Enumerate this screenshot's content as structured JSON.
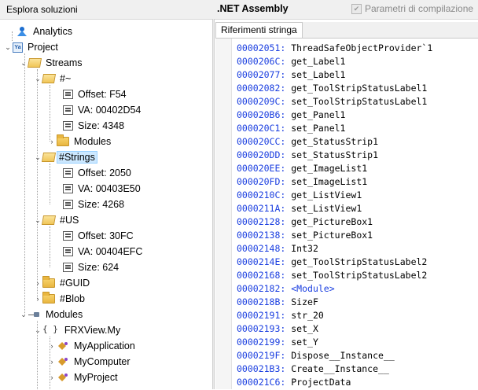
{
  "topbar": {
    "explorer_title": "Esplora soluzioni",
    "assembly_title": ".NET Assembly",
    "compile_params_label": "Parametri di compilazione",
    "compile_params_checked": true
  },
  "tree": {
    "analytics": "Analytics",
    "project": "Project",
    "streams": "Streams",
    "tilde": "#~",
    "tilde_offset": "Offset: F54",
    "tilde_va": "VA: 00402D54",
    "tilde_size": "Size: 4348",
    "tilde_modules": "Modules",
    "strings": "#Strings",
    "strings_offset": "Offset: 2050",
    "strings_va": "VA: 00403E50",
    "strings_size": "Size: 4268",
    "us": "#US",
    "us_offset": "Offset: 30FC",
    "us_va": "VA: 00404EFC",
    "us_size": "Size: 624",
    "guid": "#GUID",
    "blob": "#Blob",
    "modules": "Modules",
    "ns_brace": "{ }",
    "namespace": "FRXView.My",
    "cls1": "MyApplication",
    "cls2": "MyComputer",
    "cls3": "MyProject"
  },
  "panel": {
    "tab_label": "Riferimenti stringa"
  },
  "strings": [
    {
      "offset": "00002051:",
      "name": "ThreadSafeObjectProvider`1"
    },
    {
      "offset": "0000206C:",
      "name": "get_Label1"
    },
    {
      "offset": "00002077:",
      "name": "set_Label1"
    },
    {
      "offset": "00002082:",
      "name": "get_ToolStripStatusLabel1"
    },
    {
      "offset": "0000209C:",
      "name": "set_ToolStripStatusLabel1"
    },
    {
      "offset": "000020B6:",
      "name": "get_Panel1"
    },
    {
      "offset": "000020C1:",
      "name": "set_Panel1"
    },
    {
      "offset": "000020CC:",
      "name": "get_StatusStrip1"
    },
    {
      "offset": "000020DD:",
      "name": "set_StatusStrip1"
    },
    {
      "offset": "000020EE:",
      "name": "get_ImageList1"
    },
    {
      "offset": "000020FD:",
      "name": "set_ImageList1"
    },
    {
      "offset": "0000210C:",
      "name": "get_ListView1"
    },
    {
      "offset": "0000211A:",
      "name": "set_ListView1"
    },
    {
      "offset": "00002128:",
      "name": "get_PictureBox1"
    },
    {
      "offset": "00002138:",
      "name": "set_PictureBox1"
    },
    {
      "offset": "00002148:",
      "name": "Int32"
    },
    {
      "offset": "0000214E:",
      "name": "get_ToolStripStatusLabel2"
    },
    {
      "offset": "00002168:",
      "name": "set_ToolStripStatusLabel2"
    },
    {
      "offset": "00002182:",
      "name": "<Module>"
    },
    {
      "offset": "0000218B:",
      "name": "SizeF"
    },
    {
      "offset": "00002191:",
      "name": "str_20"
    },
    {
      "offset": "00002193:",
      "name": "set_X"
    },
    {
      "offset": "00002199:",
      "name": "set_Y"
    },
    {
      "offset": "0000219F:",
      "name": "Dispose__Instance__"
    },
    {
      "offset": "000021B3:",
      "name": "Create__Instance__"
    },
    {
      "offset": "000021C6:",
      "name": "ProjectData"
    }
  ]
}
